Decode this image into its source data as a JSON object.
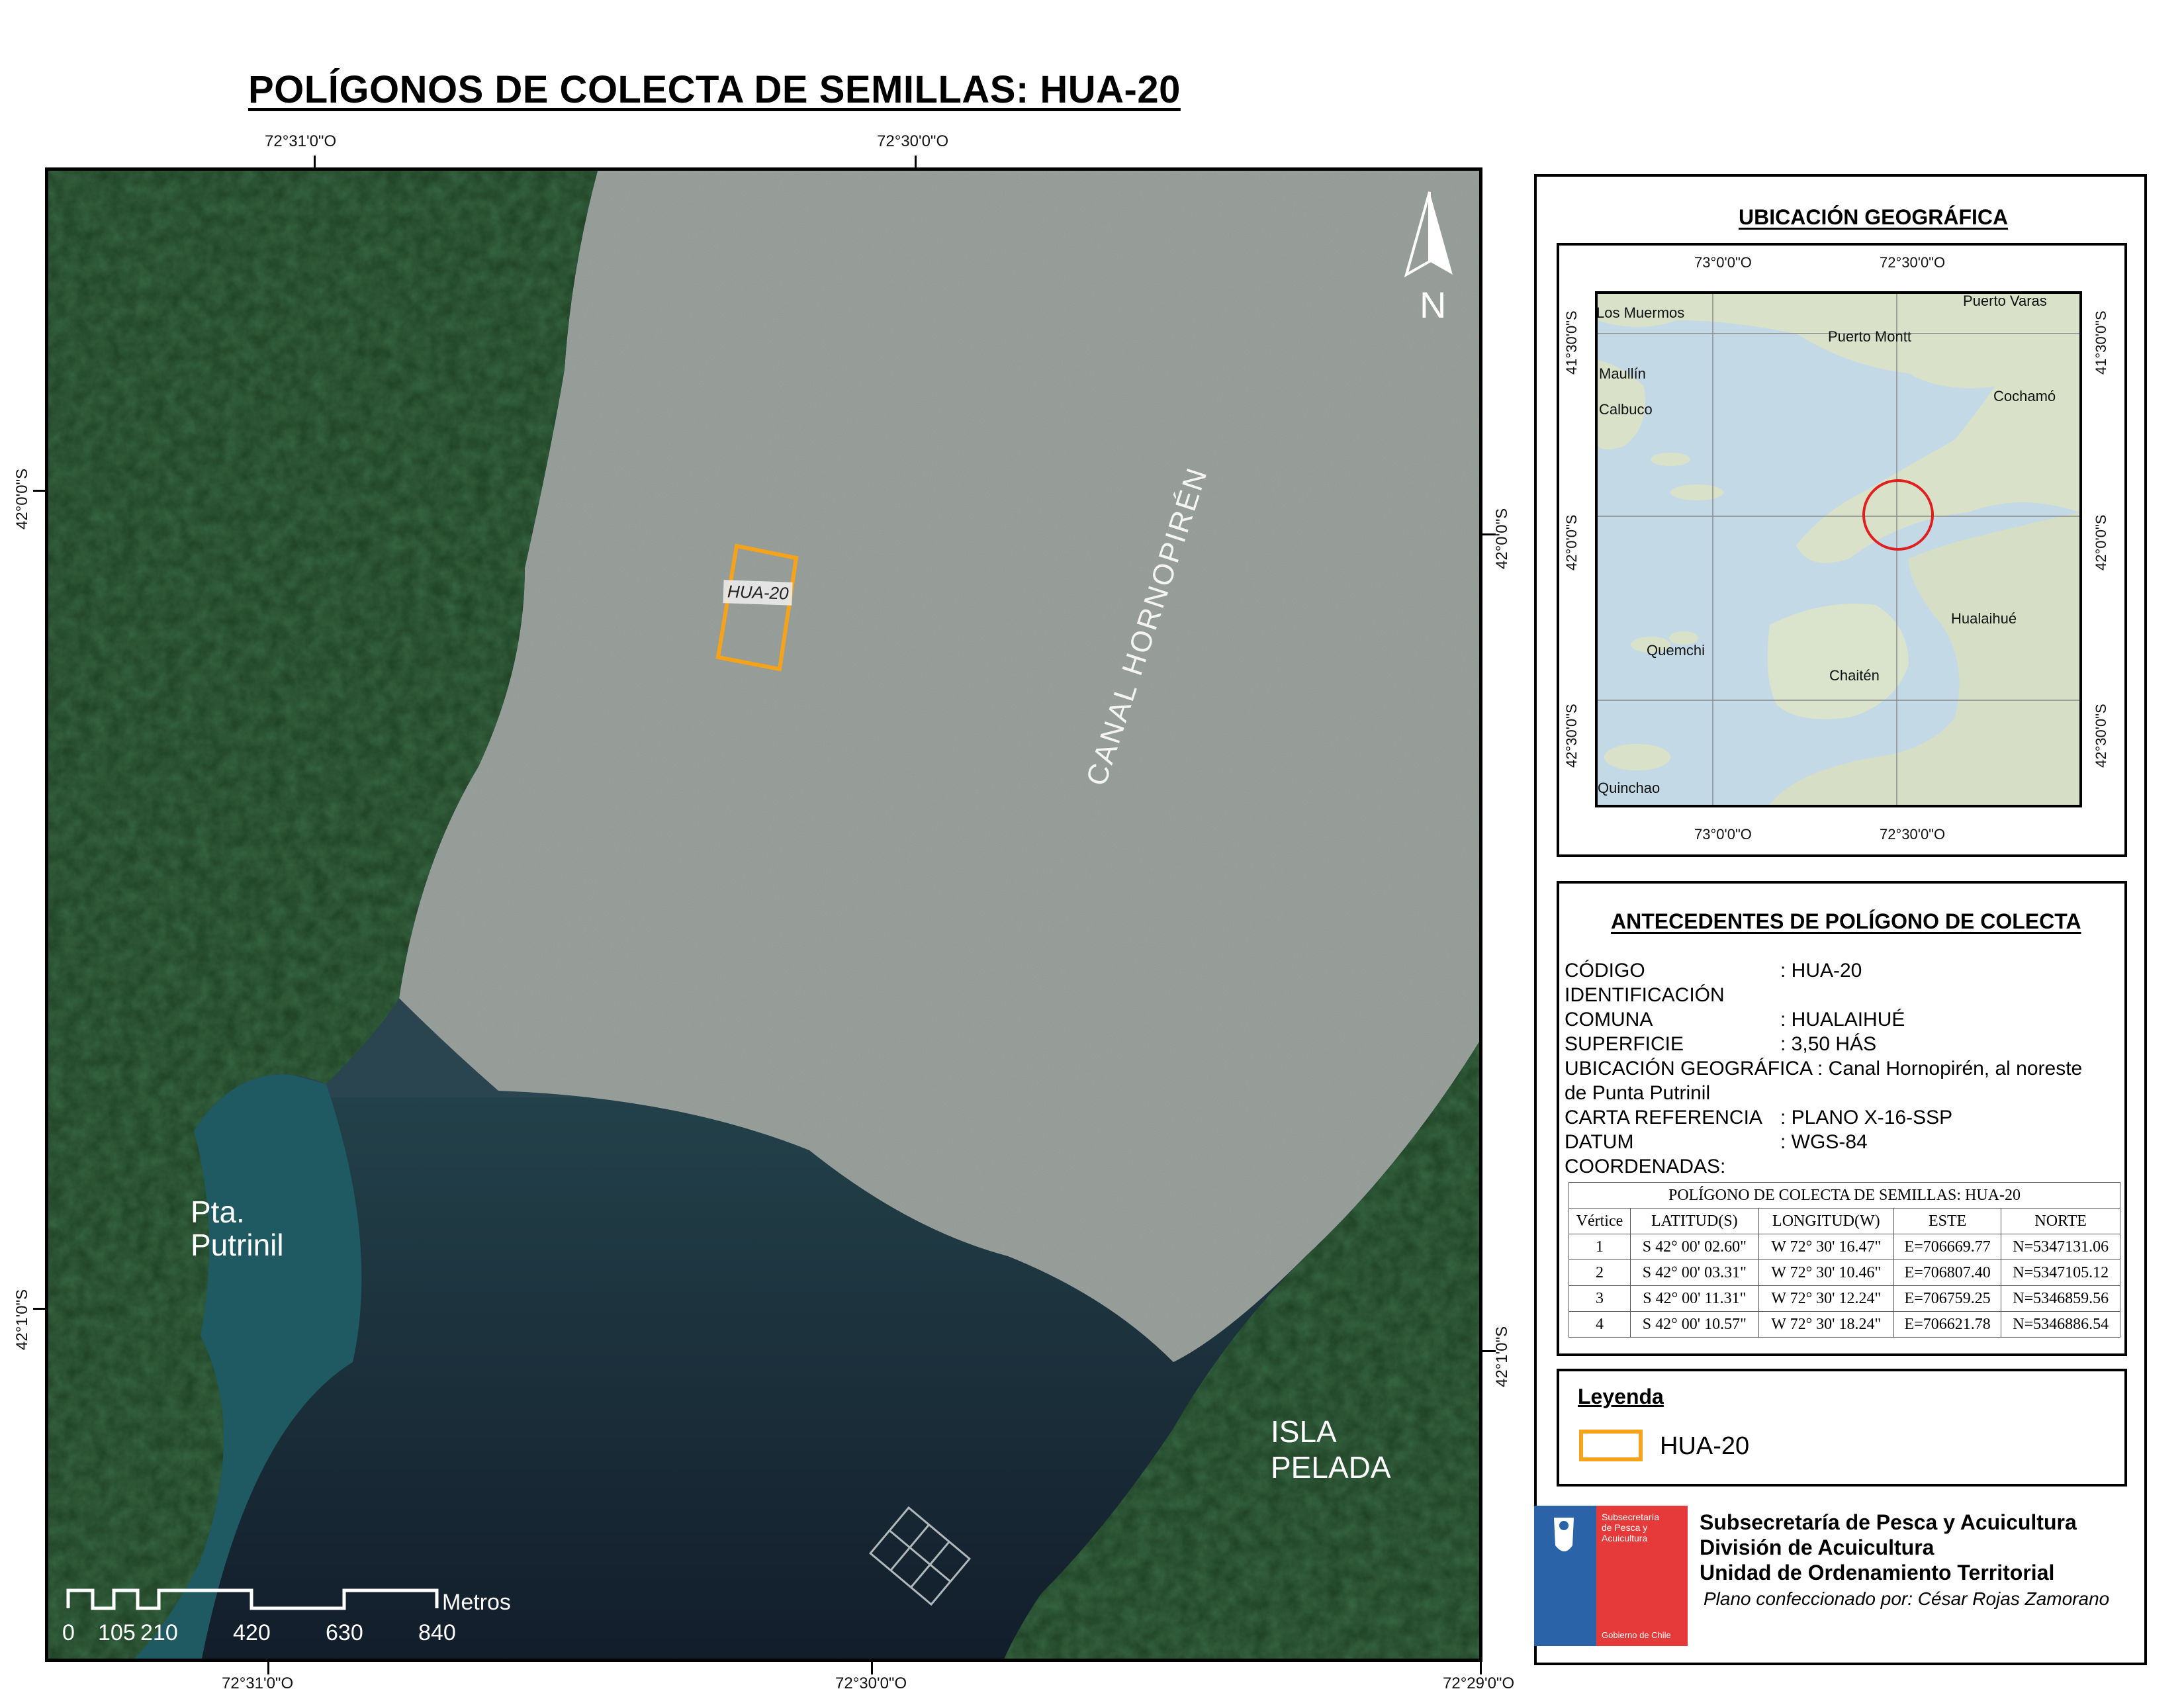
{
  "title": "POLÍGONOS DE COLECTA DE SEMILLAS: HUA-20",
  "main_map": {
    "top_coords": [
      "72°31'0\"O",
      "72°30'0\"O"
    ],
    "bottom_coords": [
      "72°31'0\"O",
      "72°30'0\"O",
      "72°29'0\"O"
    ],
    "left_coords": [
      "42°0'0\"S",
      "42°1'0\"S"
    ],
    "right_coords": [
      "42°0'0\"S",
      "42°1'0\"S"
    ],
    "labels": {
      "canal": "CANAL HORNOPIRÉN",
      "pta_line1": "Pta.",
      "pta_line2": "Putrinil",
      "isla_line1": "ISLA",
      "isla_line2": "PELADA"
    },
    "north_label": "N",
    "polygon_label": "HUA-20",
    "polygon_color": "#f5a31a",
    "scale": {
      "ticks": [
        "0",
        "105",
        "210",
        "420",
        "630",
        "840"
      ],
      "unit": "Metros"
    }
  },
  "location": {
    "title": "UBICACIÓN GEOGRÁFICA",
    "top_coords": [
      "73°0'0\"O",
      "72°30'0\"O"
    ],
    "bottom_coords": [
      "73°0'0\"O",
      "72°30'0\"O"
    ],
    "left_coords": [
      "41°30'0\"S",
      "42°0'0\"S",
      "42°30'0\"S"
    ],
    "right_coords": [
      "41°30'0\"S",
      "42°0'0\"S",
      "42°30'0\"S"
    ],
    "towns": [
      "Los Muermos",
      "Puerto Varas",
      "Puerto Montt",
      "Maullín",
      "Cochamó",
      "Calbuco",
      "Hualaihué",
      "Quemchi",
      "Chaitén",
      "Quinchao"
    ],
    "marker_color": "#e02020"
  },
  "info": {
    "title": "ANTECEDENTES DE POLÍGONO DE COLECTA",
    "rows": [
      {
        "label": "CÓDIGO",
        "value": ": HUA-20"
      },
      {
        "label": "IDENTIFICACIÓN",
        "value": ""
      },
      {
        "label": "COMUNA",
        "value": ": HUALAIHUÉ"
      },
      {
        "label": "SUPERFICIE",
        "value": ": 3,50 HÁS"
      },
      {
        "label": "UBICACIÓN GEOGRÁFICA",
        "value": ": Canal Hornopirén, al noreste"
      },
      {
        "label": "de Punta Putrinil",
        "value": ""
      },
      {
        "label": "CARTA REFERENCIA",
        "value": ": PLANO X-16-SSP"
      },
      {
        "label": "DATUM",
        "value": ": WGS-84"
      },
      {
        "label": "COORDENADAS:",
        "value": ""
      }
    ],
    "table": {
      "caption": "POLÍGONO DE COLECTA DE SEMILLAS: HUA-20",
      "headers": [
        "Vértice",
        "LATITUD(S)",
        "LONGITUD(W)",
        "ESTE",
        "NORTE"
      ],
      "rows": [
        [
          "1",
          "S 42° 00' 02.60\"",
          "W 72° 30' 16.47\"",
          "E=706669.77",
          "N=5347131.06"
        ],
        [
          "2",
          "S 42° 00' 03.31\"",
          "W 72° 30' 10.46\"",
          "E=706807.40",
          "N=5347105.12"
        ],
        [
          "3",
          "S 42° 00' 11.31\"",
          "W 72° 30' 12.24\"",
          "E=706759.25",
          "N=5346859.56"
        ],
        [
          "4",
          "S 42° 00' 10.57\"",
          "W 72° 30' 18.24\"",
          "E=706621.78",
          "N=5346886.54"
        ]
      ]
    }
  },
  "legend": {
    "title": "Leyenda",
    "item": "HUA-20",
    "color": "#f5a31a"
  },
  "footer": {
    "logo_text1": "Subsecretaría",
    "logo_text2": "de Pesca y",
    "logo_text3": "Acuicultura",
    "logo_bottom": "Gobierno de Chile",
    "line1": "Subsecretaría de Pesca y Acuicultura",
    "line2": "División de Acuicultura",
    "line3": "Unidad de Ordenamiento Territorial",
    "author": "Plano confeccionado por: César Rojas Zamorano"
  }
}
